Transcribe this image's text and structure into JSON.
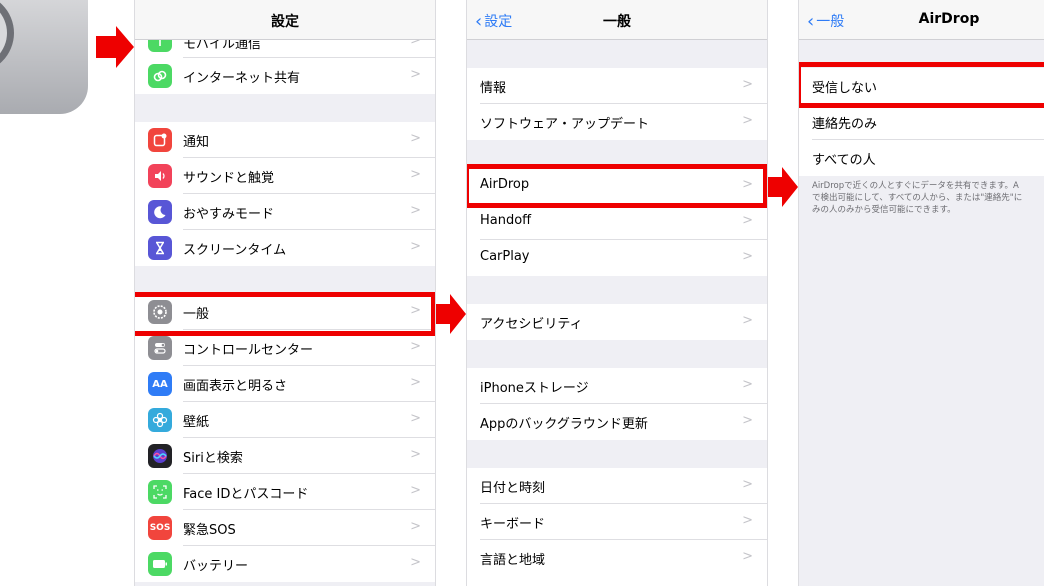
{
  "panel1": {
    "title": "設定",
    "items": [
      {
        "label": "モバイル通信",
        "icon": "antenna-icon",
        "color": "#4cd964"
      },
      {
        "label": "インターネット共有",
        "icon": "link-icon",
        "color": "#4cd964"
      },
      {
        "label": "通知",
        "icon": "notification-icon",
        "color": "#f1453d"
      },
      {
        "label": "サウンドと触覚",
        "icon": "speaker-icon",
        "color": "#f2435a"
      },
      {
        "label": "おやすみモード",
        "icon": "moon-icon",
        "color": "#5856d6"
      },
      {
        "label": "スクリーンタイム",
        "icon": "hourglass-icon",
        "color": "#5856d6"
      },
      {
        "label": "一般",
        "icon": "gear-icon",
        "color": "#8e8e93"
      },
      {
        "label": "コントロールセンター",
        "icon": "toggles-icon",
        "color": "#8e8e93"
      },
      {
        "label": "画面表示と明るさ",
        "icon": "text-size-icon",
        "color": "#2f7cf6"
      },
      {
        "label": "壁紙",
        "icon": "flower-icon",
        "color": "#34aadc"
      },
      {
        "label": "Siriと検索",
        "icon": "siri-icon",
        "color": "#222226"
      },
      {
        "label": "Face IDとパスコード",
        "icon": "face-id-icon",
        "color": "#4cd964"
      },
      {
        "label": "緊急SOS",
        "icon": "sos-icon",
        "color": "#f1453d"
      },
      {
        "label": "バッテリー",
        "icon": "battery-icon",
        "color": "#4cd964"
      }
    ]
  },
  "panel2": {
    "title": "一般",
    "back": "設定",
    "items": [
      {
        "label": "情報"
      },
      {
        "label": "ソフトウェア・アップデート"
      },
      {
        "label": "AirDrop"
      },
      {
        "label": "Handoff"
      },
      {
        "label": "CarPlay"
      },
      {
        "label": "アクセシビリティ"
      },
      {
        "label": "iPhoneストレージ"
      },
      {
        "label": "Appのバックグラウンド更新"
      },
      {
        "label": "日付と時刻"
      },
      {
        "label": "キーボード"
      },
      {
        "label": "言語と地域"
      }
    ]
  },
  "panel3": {
    "title": "AirDrop",
    "back": "一般",
    "options": [
      {
        "label": "受信しない"
      },
      {
        "label": "連絡先のみ"
      },
      {
        "label": "すべての人"
      }
    ],
    "footer_lines": [
      "AirDropで近くの人とすぐにデータを共有できます。A",
      "で検出可能にして、すべての人から、または\"連絡先\"に",
      "みの人のみから受信可能にできます。"
    ]
  },
  "sos_text": "SOS",
  "aa_text": "AA",
  "colors": {
    "highlight": "#ee0000",
    "accent": "#2f7cf6",
    "background": "#efeff4"
  }
}
